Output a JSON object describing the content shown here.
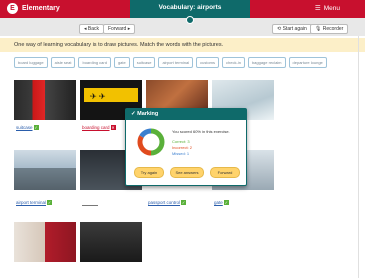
{
  "header": {
    "brand_letter": "E",
    "brand": "Elementary",
    "section_title": "Vocabulary: airports",
    "menu_label": "Menu",
    "back_label": "Back",
    "forward_label": "Forward",
    "start_again_label": "Start again",
    "recorder_label": "Recorder"
  },
  "instructions": "One way of learning vocabulary is to draw pictures. Match the words with the pictures.",
  "word_bank": [
    "board luggage",
    "aisle seat",
    "boarding card",
    "gate",
    "suitcase",
    "airport terminal",
    "customs",
    "check-in",
    "baggage reclaim",
    "departure lounge"
  ],
  "answers": [
    {
      "text": "suitcase",
      "status": "correct"
    },
    {
      "text": "boarding card",
      "status": "wrong"
    },
    {
      "text": "airport terminal",
      "status": "correct"
    },
    {
      "text": "",
      "status": "empty"
    },
    {
      "text": "passport control",
      "status": "correct"
    },
    {
      "text": "gate",
      "status": "correct"
    }
  ],
  "marking": {
    "title": "Marking",
    "summary": "You scored 60% in this exercise.",
    "correct_line": "Correct: 3",
    "incorrect_line": "Incorrect: 2",
    "missed_line": "Missed: 1",
    "correct": 3,
    "incorrect": 2,
    "missed": 1,
    "score_percent": 60,
    "buttons": {
      "try_again": "Try again",
      "see_answers": "See answers",
      "forward": "Forward"
    }
  },
  "colors": {
    "red": "#c8102e",
    "teal": "#0f6a6a",
    "correct": "#5ab03a",
    "incorrect": "#e04a1e",
    "missed": "#3a7fcf",
    "button": "#ffd36b"
  },
  "icons": {
    "check": "✓",
    "cross": "✕"
  }
}
